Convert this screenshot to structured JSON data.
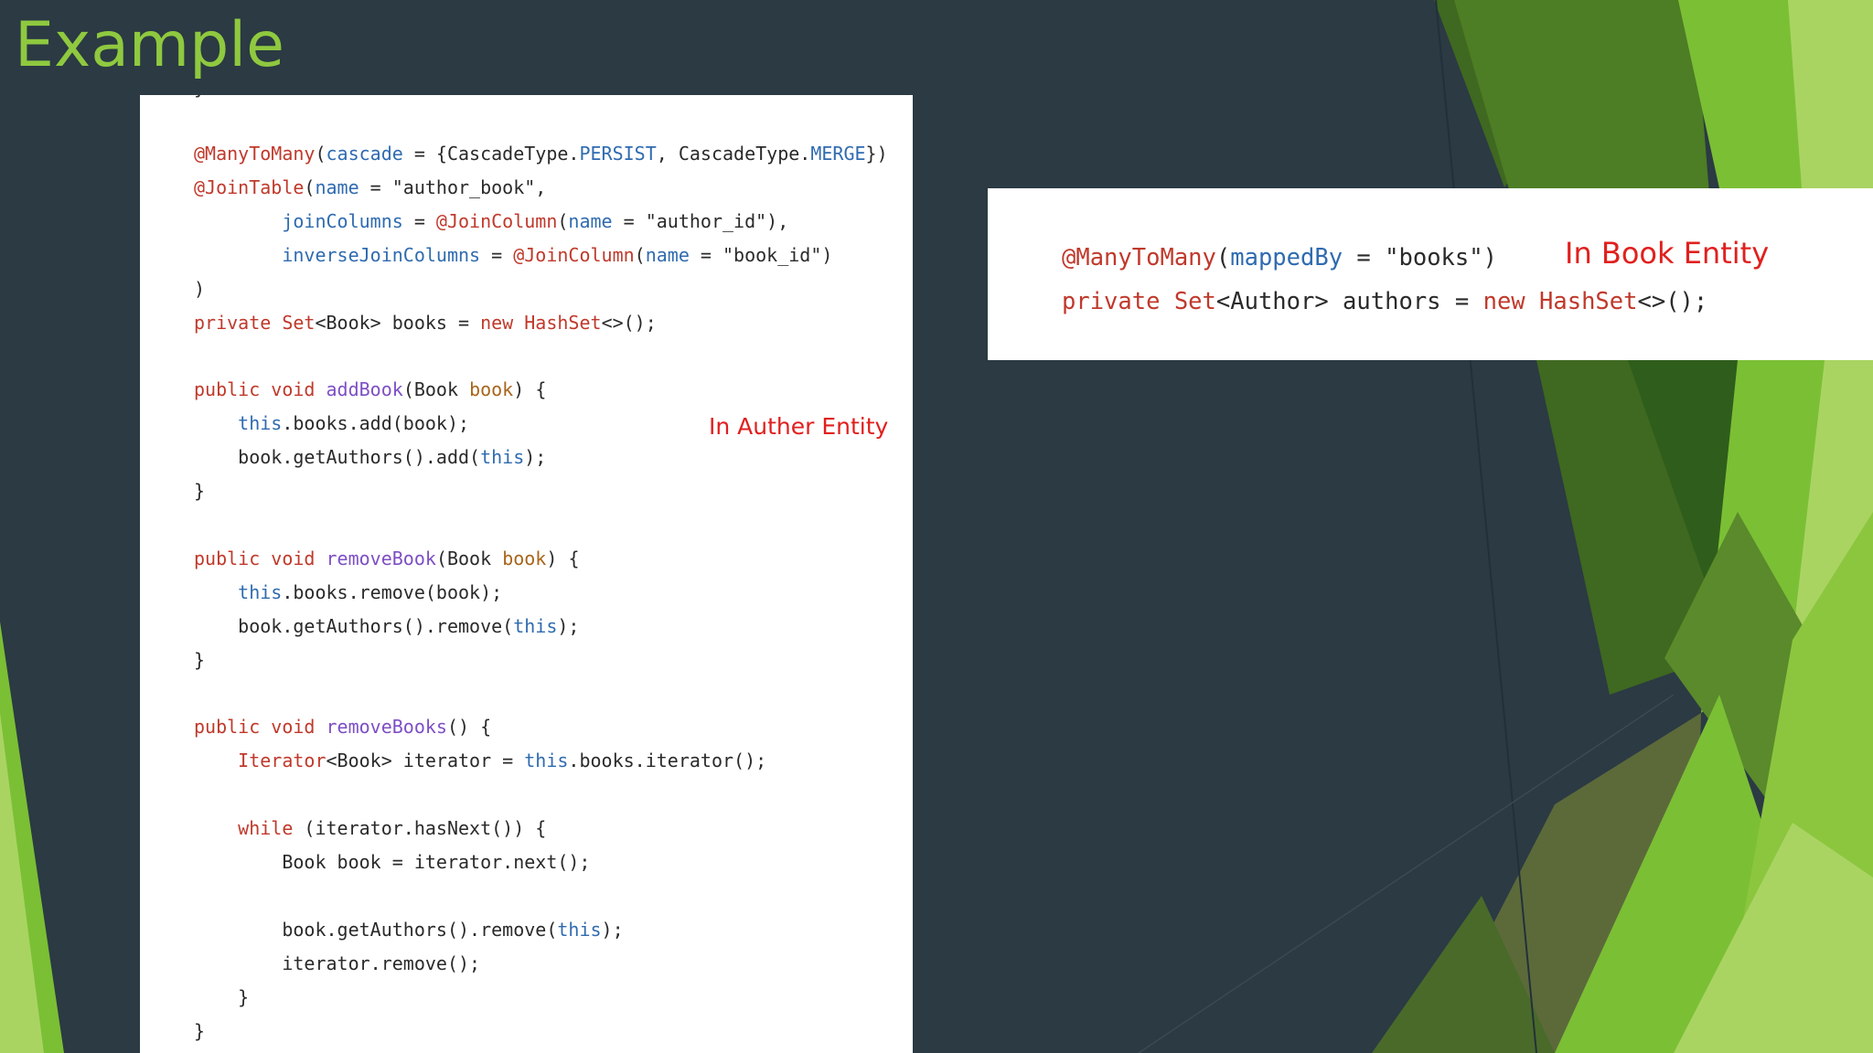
{
  "slide": {
    "title": "Example",
    "colors": {
      "background": "#2b3a43",
      "title": "#8fc93f",
      "accent_green": "#7bbf35",
      "note_red": "#e0201e",
      "keyword_red": "#c0392b",
      "identifier_blue": "#2f6bb0",
      "method_purple": "#7d4fc4"
    }
  },
  "author_code": {
    "note": "In Auther Entity",
    "clipped_line": "}",
    "lines": [
      "@ManyToMany(cascade = {CascadeType.PERSIST, CascadeType.MERGE})",
      "@JoinTable(name = \"author_book\",",
      "        joinColumns = @JoinColumn(name = \"author_id\"),",
      "        inverseJoinColumns = @JoinColumn(name = \"book_id\")",
      ")",
      "private Set<Book> books = new HashSet<>();",
      "",
      "public void addBook(Book book) {",
      "    this.books.add(book);",
      "    book.getAuthors().add(this);",
      "}",
      "",
      "public void removeBook(Book book) {",
      "    this.books.remove(book);",
      "    book.getAuthors().remove(this);",
      "}",
      "",
      "public void removeBooks() {",
      "    Iterator<Book> iterator = this.books.iterator();",
      "",
      "    while (iterator.hasNext()) {",
      "        Book book = iterator.next();",
      "",
      "        book.getAuthors().remove(this);",
      "        iterator.remove();",
      "    }",
      "}"
    ]
  },
  "book_code": {
    "note": "In Book Entity",
    "lines": [
      "@ManyToMany(mappedBy = \"books\")",
      "private Set<Author> authors = new HashSet<>();"
    ]
  }
}
